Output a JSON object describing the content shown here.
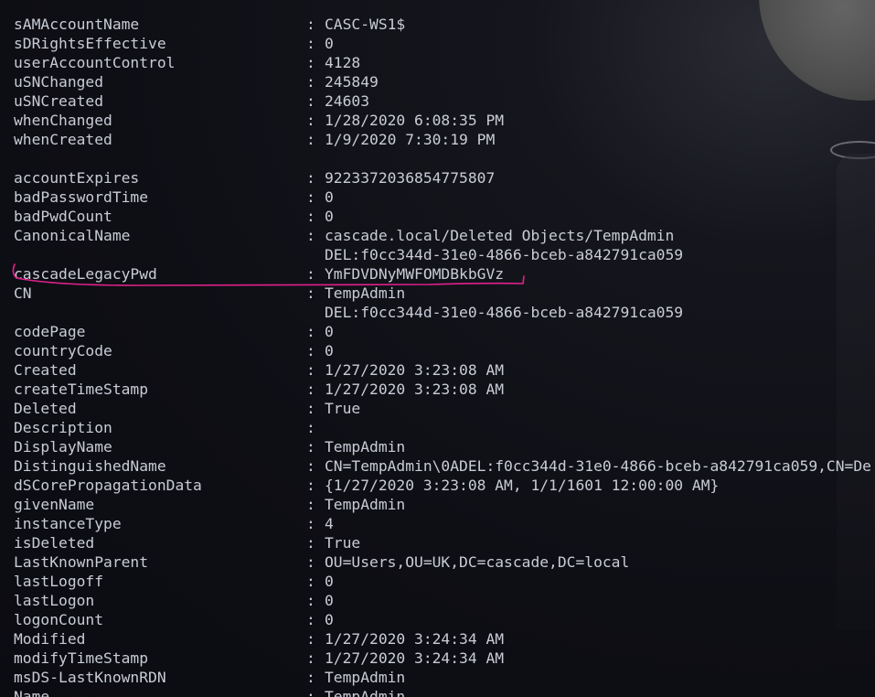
{
  "colors": {
    "text": "#c9ccd6",
    "annotation": "#e0208c",
    "background": "#0e0f15"
  },
  "group1": [
    {
      "key": "sAMAccountName",
      "value": "CASC-WS1$"
    },
    {
      "key": "sDRightsEffective",
      "value": "0"
    },
    {
      "key": "userAccountControl",
      "value": "4128"
    },
    {
      "key": "uSNChanged",
      "value": "245849"
    },
    {
      "key": "uSNCreated",
      "value": "24603"
    },
    {
      "key": "whenChanged",
      "value": "1/28/2020 6:08:35 PM"
    },
    {
      "key": "whenCreated",
      "value": "1/9/2020 7:30:19 PM"
    }
  ],
  "group2": [
    {
      "key": "accountExpires",
      "value": "9223372036854775807"
    },
    {
      "key": "badPasswordTime",
      "value": "0"
    },
    {
      "key": "badPwdCount",
      "value": "0"
    },
    {
      "key": "CanonicalName",
      "value": "cascade.local/Deleted Objects/TempAdmin"
    },
    {
      "key": "",
      "value": "DEL:f0cc344d-31e0-4866-bceb-a842791ca059"
    },
    {
      "key": "cascadeLegacyPwd",
      "value": "YmFDVDNyMWFOMDBkbGVz"
    },
    {
      "key": "CN",
      "value": "TempAdmin"
    },
    {
      "key": "",
      "value": "DEL:f0cc344d-31e0-4866-bceb-a842791ca059"
    },
    {
      "key": "codePage",
      "value": "0"
    },
    {
      "key": "countryCode",
      "value": "0"
    },
    {
      "key": "Created",
      "value": "1/27/2020 3:23:08 AM"
    },
    {
      "key": "createTimeStamp",
      "value": "1/27/2020 3:23:08 AM"
    },
    {
      "key": "Deleted",
      "value": "True"
    },
    {
      "key": "Description",
      "value": ""
    },
    {
      "key": "DisplayName",
      "value": "TempAdmin"
    },
    {
      "key": "DistinguishedName",
      "value": "CN=TempAdmin\\0ADEL:f0cc344d-31e0-4866-bceb-a842791ca059,CN=De"
    },
    {
      "key": "dSCorePropagationData",
      "value": "{1/27/2020 3:23:08 AM, 1/1/1601 12:00:00 AM}"
    },
    {
      "key": "givenName",
      "value": "TempAdmin"
    },
    {
      "key": "instanceType",
      "value": "4"
    },
    {
      "key": "isDeleted",
      "value": "True"
    },
    {
      "key": "LastKnownParent",
      "value": "OU=Users,OU=UK,DC=cascade,DC=local"
    },
    {
      "key": "lastLogoff",
      "value": "0"
    },
    {
      "key": "lastLogon",
      "value": "0"
    },
    {
      "key": "logonCount",
      "value": "0"
    },
    {
      "key": "Modified",
      "value": "1/27/2020 3:24:34 AM"
    },
    {
      "key": "modifyTimeStamp",
      "value": "1/27/2020 3:24:34 AM"
    },
    {
      "key": "msDS-LastKnownRDN",
      "value": "TempAdmin"
    },
    {
      "key": "Name",
      "value": "TempAdmin"
    }
  ]
}
